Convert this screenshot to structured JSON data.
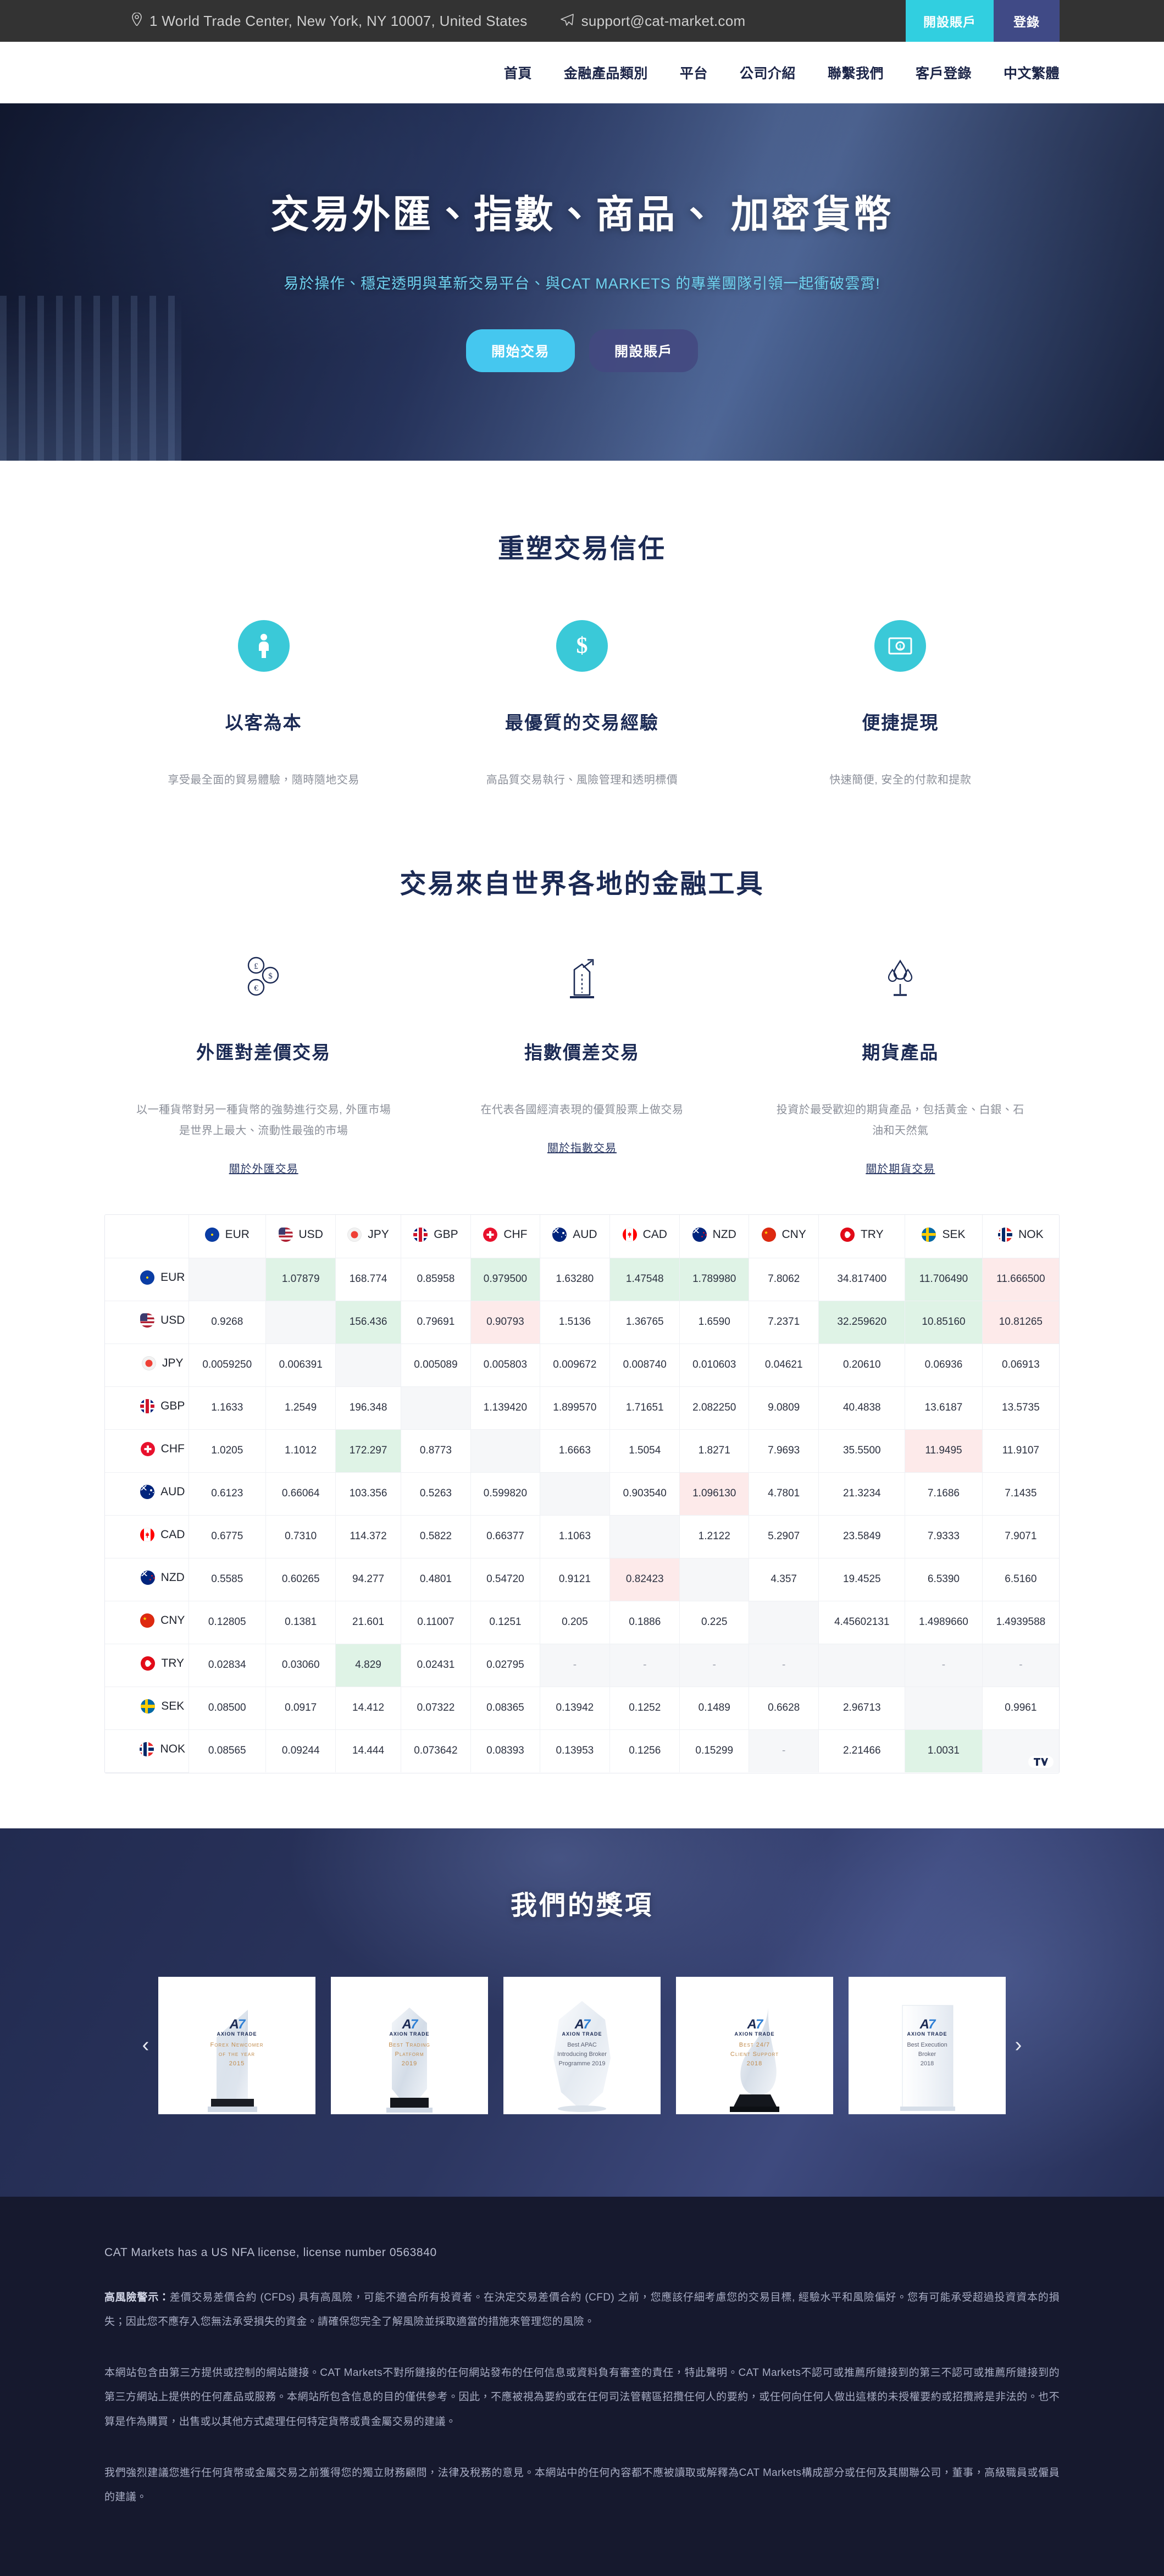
{
  "topbar": {
    "address": "1 World Trade Center, New York, NY 10007, United States",
    "email": "support@cat-market.com",
    "open_account": "開設賬戶",
    "login": "登錄"
  },
  "nav": {
    "items": [
      {
        "label": "首頁"
      },
      {
        "label": "金融產品類別"
      },
      {
        "label": "平台"
      },
      {
        "label": "公司介紹"
      },
      {
        "label": "聯繫我們"
      },
      {
        "label": "客戶登錄"
      },
      {
        "label": "中文繁體"
      }
    ]
  },
  "hero": {
    "title": "交易外匯、指數、商品、 加密貨幣",
    "subtitle": "易於操作、穩定透明與革新交易平台、與CAT MARKETS 的專業團隊引領一起衝破雲霄!",
    "btn_primary": "開始交易",
    "btn_secondary": "開設賬戶"
  },
  "trust": {
    "title": "重塑交易信任",
    "cards": [
      {
        "icon": "person-icon",
        "title": "以客為本",
        "desc": "享受最全面的貿易體驗，隨時隨地交易"
      },
      {
        "icon": "dollar-icon",
        "title": "最優質的交易經驗",
        "desc": "高品質交易執行、風險管理和透明標價"
      },
      {
        "icon": "banknote-icon",
        "title": "便捷提現",
        "desc": "快速簡便, 安全的付款和提款"
      }
    ]
  },
  "instruments": {
    "title": "交易來自世界各地的金融工具",
    "cards": [
      {
        "icon": "currency-coins-icon",
        "title": "外匯對差價交易",
        "desc": "以一種貨幣對另一種貨幣的強勢進行交易, 外匯市場是世界上最大、流動性最強的市場",
        "link": "關於外匯交易"
      },
      {
        "icon": "chart-growth-icon",
        "title": "指數價差交易",
        "desc": "在代表各國經濟表現的優質股票上做交易",
        "link": "關於指數交易"
      },
      {
        "icon": "oil-drop-icon",
        "title": "期貨產品",
        "desc": "投資於最受歡迎的期貨產品，包括黃金、白銀、石油和天然氣",
        "link": "關於期貨交易"
      }
    ]
  },
  "fx_table": {
    "currencies": [
      "EUR",
      "USD",
      "JPY",
      "GBP",
      "CHF",
      "AUD",
      "CAD",
      "NZD",
      "CNY",
      "TRY",
      "SEK",
      "NOK"
    ],
    "flag_classes": [
      "f-eur",
      "f-usd",
      "f-jpy",
      "f-gbp",
      "f-chf",
      "f-aud",
      "f-cad",
      "f-nzd",
      "f-cny",
      "f-try",
      "f-sek",
      "f-nok"
    ],
    "attribution": "TV",
    "rows": [
      {
        "currency": "EUR",
        "cells": [
          "",
          "1.07879",
          "168.774",
          "0.85958",
          "0.979500",
          "1.63280",
          "1.47548",
          "1.789980",
          "7.8062",
          "34.817400",
          "11.706490",
          "11.666500"
        ],
        "states": [
          "self",
          "up",
          "none",
          "none",
          "up",
          "none",
          "up",
          "up",
          "none",
          "none",
          "up",
          "down"
        ]
      },
      {
        "currency": "USD",
        "cells": [
          "0.9268",
          "",
          "156.436",
          "0.79691",
          "0.90793",
          "1.5136",
          "1.36765",
          "1.6590",
          "7.2371",
          "32.259620",
          "10.85160",
          "10.81265"
        ],
        "states": [
          "none",
          "self",
          "up",
          "none",
          "down",
          "none",
          "none",
          "none",
          "none",
          "up",
          "up",
          "down"
        ]
      },
      {
        "currency": "JPY",
        "cells": [
          "0.0059250",
          "0.006391",
          "",
          "0.005089",
          "0.005803",
          "0.009672",
          "0.008740",
          "0.010603",
          "0.04621",
          "0.20610",
          "0.06936",
          "0.06913"
        ],
        "states": [
          "none",
          "none",
          "self",
          "none",
          "none",
          "none",
          "none",
          "none",
          "none",
          "none",
          "none",
          "none"
        ]
      },
      {
        "currency": "GBP",
        "cells": [
          "1.1633",
          "1.2549",
          "196.348",
          "",
          "1.139420",
          "1.899570",
          "1.71651",
          "2.082250",
          "9.0809",
          "40.4838",
          "13.6187",
          "13.5735"
        ],
        "states": [
          "none",
          "none",
          "none",
          "self",
          "none",
          "none",
          "none",
          "none",
          "none",
          "none",
          "none",
          "none"
        ]
      },
      {
        "currency": "CHF",
        "cells": [
          "1.0205",
          "1.1012",
          "172.297",
          "0.8773",
          "",
          "1.6663",
          "1.5054",
          "1.8271",
          "7.9693",
          "35.5500",
          "11.9495",
          "11.9107"
        ],
        "states": [
          "none",
          "none",
          "up",
          "none",
          "self",
          "none",
          "none",
          "none",
          "none",
          "none",
          "down",
          "none"
        ]
      },
      {
        "currency": "AUD",
        "cells": [
          "0.6123",
          "0.66064",
          "103.356",
          "0.5263",
          "0.599820",
          "",
          "0.903540",
          "1.096130",
          "4.7801",
          "21.3234",
          "7.1686",
          "7.1435"
        ],
        "states": [
          "none",
          "none",
          "none",
          "none",
          "none",
          "self",
          "none",
          "down",
          "none",
          "none",
          "none",
          "none"
        ]
      },
      {
        "currency": "CAD",
        "cells": [
          "0.6775",
          "0.7310",
          "114.372",
          "0.5822",
          "0.66377",
          "1.1063",
          "",
          "1.2122",
          "5.2907",
          "23.5849",
          "7.9333",
          "7.9071"
        ],
        "states": [
          "none",
          "none",
          "none",
          "none",
          "none",
          "none",
          "self",
          "none",
          "none",
          "none",
          "none",
          "none"
        ]
      },
      {
        "currency": "NZD",
        "cells": [
          "0.5585",
          "0.60265",
          "94.277",
          "0.4801",
          "0.54720",
          "0.9121",
          "0.82423",
          "",
          "4.357",
          "19.4525",
          "6.5390",
          "6.5160"
        ],
        "states": [
          "none",
          "none",
          "none",
          "none",
          "none",
          "none",
          "down",
          "self",
          "none",
          "none",
          "none",
          "none"
        ]
      },
      {
        "currency": "CNY",
        "cells": [
          "0.12805",
          "0.1381",
          "21.601",
          "0.11007",
          "0.1251",
          "0.205",
          "0.1886",
          "0.225",
          "",
          "4.45602131",
          "1.4989660",
          "1.4939588"
        ],
        "states": [
          "none",
          "none",
          "none",
          "none",
          "none",
          "none",
          "none",
          "none",
          "self",
          "none",
          "none",
          "none"
        ]
      },
      {
        "currency": "TRY",
        "cells": [
          "0.02834",
          "0.03060",
          "4.829",
          "0.02431",
          "0.02795",
          "-",
          "-",
          "-",
          "-",
          "",
          "-",
          "-"
        ],
        "states": [
          "none",
          "none",
          "up",
          "none",
          "none",
          "self",
          "self",
          "self",
          "self",
          "self",
          "self",
          "self"
        ]
      },
      {
        "currency": "SEK",
        "cells": [
          "0.08500",
          "0.0917",
          "14.412",
          "0.07322",
          "0.08365",
          "0.13942",
          "0.1252",
          "0.1489",
          "0.6628",
          "2.96713",
          "",
          "0.9961"
        ],
        "states": [
          "none",
          "none",
          "none",
          "none",
          "none",
          "none",
          "none",
          "none",
          "none",
          "none",
          "self",
          "none"
        ]
      },
      {
        "currency": "NOK",
        "cells": [
          "0.08565",
          "0.09244",
          "14.444",
          "0.073642",
          "0.08393",
          "0.13953",
          "0.1256",
          "0.15299",
          "-",
          "2.21466",
          "1.0031",
          ""
        ],
        "states": [
          "none",
          "none",
          "none",
          "none",
          "none",
          "none",
          "none",
          "none",
          "self",
          "none",
          "up",
          "self"
        ]
      }
    ]
  },
  "awards": {
    "title": "我們的獎項",
    "prev": "‹",
    "next": "›",
    "brand": "AXION TRADE",
    "items": [
      {
        "shape": "wing",
        "caption": "Forex Newcomer\nof the year\n2015",
        "caption_style": "gold"
      },
      {
        "shape": "obelisk",
        "caption": "Best Trading\nPlatform\n2019",
        "caption_style": "gold"
      },
      {
        "shape": "hex",
        "caption": "Best APAC\nIntroducing Broker\nProgramme 2019",
        "caption_style": "plain"
      },
      {
        "shape": "flame",
        "caption": "Best 24/7\nClient Support\n2018",
        "caption_style": "gold"
      },
      {
        "shape": "plate",
        "caption": "Best Execution\nBroker\n2018",
        "caption_style": "plain"
      }
    ]
  },
  "footer": {
    "license": "CAT Markets has a US NFA license, license number 0563840",
    "risk_label": "高風險警示：",
    "risk_text": "差價交易差價合約 (CFDs) 具有高風險，可能不適合所有投資者。在決定交易差價合約 (CFD) 之前，您應該仔細考慮您的交易目標, 經驗水平和風險偏好。您有可能承受超過投資資本的損失；因此您不應存入您無法承受損失的資金。請確保您完全了解風險並採取適當的措施來管理您的風險。",
    "para2": "本網站包含由第三方提供或控制的網站鏈接。CAT Markets不對所鏈接的任何網站發布的任何信息或資料負有審查的責任，特此聲明。CAT Markets不認可或推薦所鏈接到的第三不認可或推薦所鏈接到的第三方網站上提供的任何產品或服務。本網站所包含信息的目的僅供參考。因此，不應被視為要約或在任何司法管轄區招攬任何人的要約，或任何向任何人做出這樣的未授權要約或招攬將是非法的。也不算是作為購買，出售或以其他方式處理任何特定貨幣或貴金屬交易的建議。",
    "para3": "我們強烈建議您進行任何貨幣或金屬交易之前獲得您的獨立財務顧問，法律及稅務的意見。本網站中的任何內容都不應被讀取或解釋為CAT Markets構成部分或任何及其關聯公司，董事，高級職員或僱員的建議。"
  }
}
